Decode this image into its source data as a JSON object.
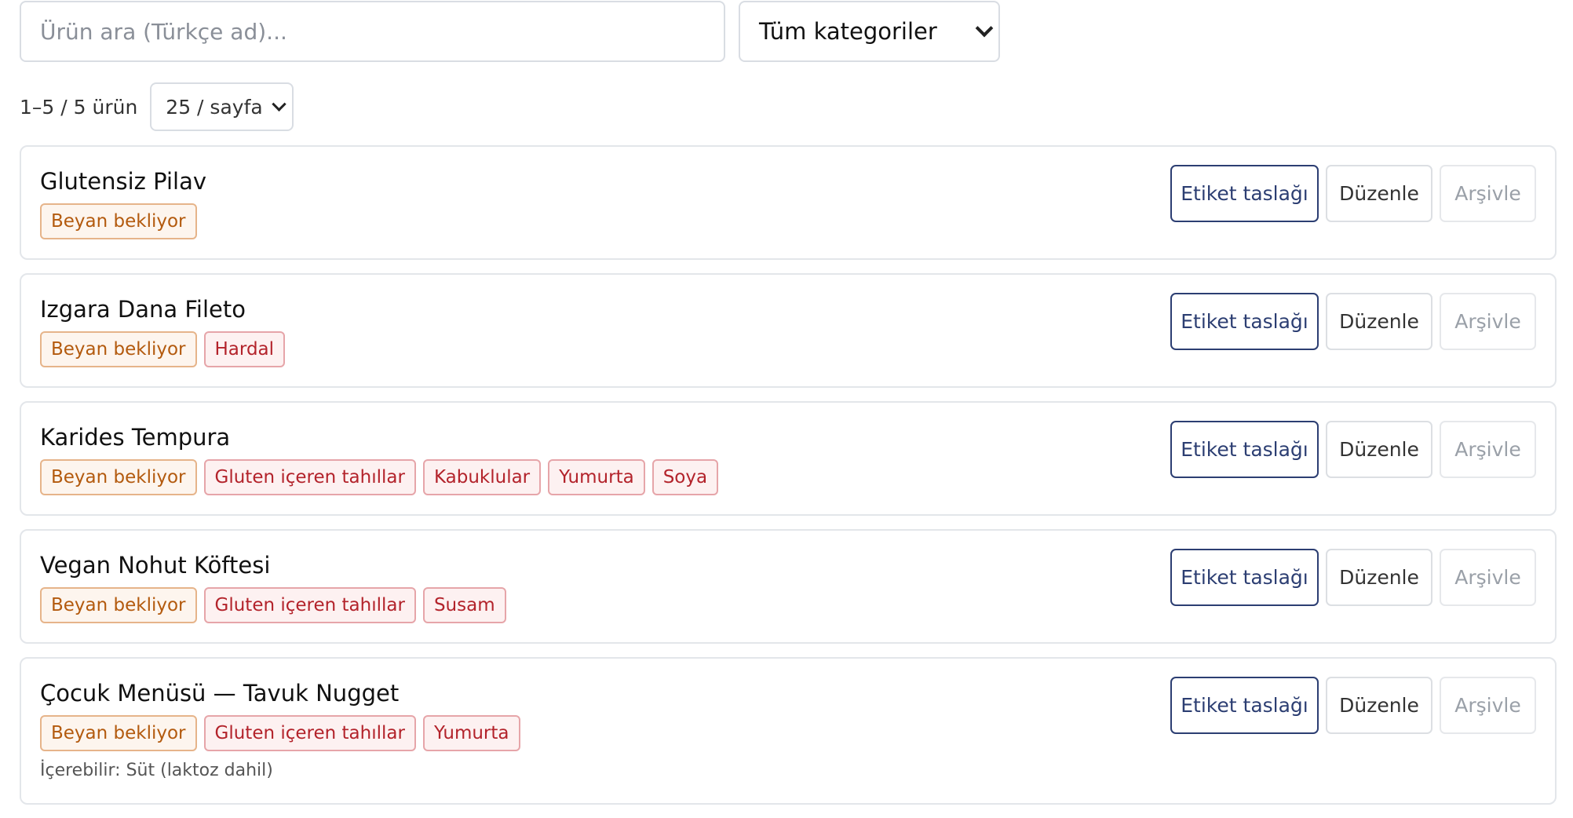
{
  "search": {
    "placeholder": "Ürün ara (Türkçe ad)...",
    "value": ""
  },
  "category_filter": {
    "selected": "Tüm kategoriler"
  },
  "pagination": {
    "count_text": "1–5 / 5 ürün",
    "per_page": "25 / sayfa"
  },
  "actions": {
    "label_draft": "Etiket taslağı",
    "edit": "Düzenle",
    "archive": "Arşivle"
  },
  "products": [
    {
      "name": "Glutensiz Pilav",
      "status": "Beyan bekliyor",
      "allergens": []
    },
    {
      "name": "Izgara Dana Fileto",
      "status": "Beyan bekliyor",
      "allergens": [
        "Hardal"
      ]
    },
    {
      "name": "Karides Tempura",
      "status": "Beyan bekliyor",
      "allergens": [
        "Gluten içeren tahıllar",
        "Kabuklular",
        "Yumurta",
        "Soya"
      ]
    },
    {
      "name": "Vegan Nohut Köftesi",
      "status": "Beyan bekliyor",
      "allergens": [
        "Gluten içeren tahıllar",
        "Susam"
      ]
    },
    {
      "name": "Çocuk Menüsü — Tavuk Nugget",
      "status": "Beyan bekliyor",
      "allergens": [
        "Gluten içeren tahıllar",
        "Yumurta"
      ],
      "may_contain": "İçerebilir: Süt (laktoz dahil)"
    }
  ],
  "colors": {
    "primary": "#2c3e72",
    "pending_text": "#b35a0e",
    "allergen_text": "#b3232b",
    "border": "#e3e6ea"
  }
}
